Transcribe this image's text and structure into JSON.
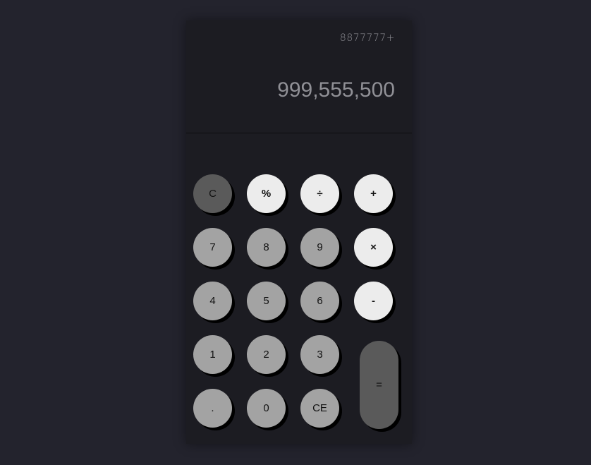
{
  "display": {
    "history": "8877777+",
    "result": "999,555,500"
  },
  "keys": {
    "clear": "C",
    "percent": "%",
    "divide": "÷",
    "add": "+",
    "seven": "7",
    "eight": "8",
    "nine": "9",
    "multiply": "×",
    "four": "4",
    "five": "5",
    "six": "6",
    "subtract": "-",
    "one": "1",
    "two": "2",
    "three": "3",
    "equals": "=",
    "decimal": ".",
    "zero": "0",
    "clear_entry": "CE"
  },
  "colors": {
    "background": "#23232d",
    "panel": "#1c1c22",
    "number_key": "#a3a3a3",
    "operator_key": "#ececec",
    "clear_key": "#5a5a5a",
    "equals_key": "#5a5a5a"
  }
}
